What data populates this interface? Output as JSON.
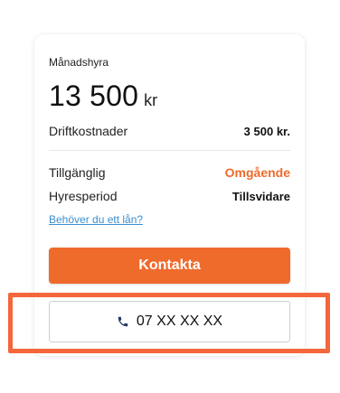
{
  "card": {
    "rent_label": "Månadshyra",
    "price": "13 500",
    "currency": "kr",
    "costs_label": "Driftkostnader",
    "costs_value": "3 500 kr.",
    "available_label": "Tillgänglig",
    "available_value": "Omgående",
    "period_label": "Hyresperiod",
    "period_value": "Tillsvidare",
    "loan_link": "Behöver du ett lån?",
    "contact_label": "Kontakta",
    "phone_label": "07 XX XX XX",
    "phone_icon": "phone-icon"
  },
  "colors": {
    "accent": "#ef6b2c",
    "link": "#3a8fd0",
    "highlight": "#f4663b"
  }
}
